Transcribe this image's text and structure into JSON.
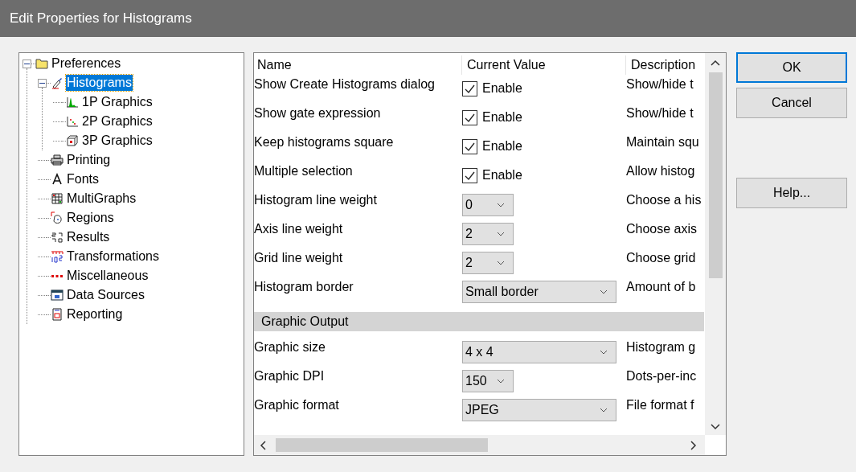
{
  "window": {
    "title": "Edit Properties for Histograms"
  },
  "tree": [
    {
      "label": "Preferences",
      "expanded": true,
      "selected": false,
      "children": [
        {
          "label": "Histograms",
          "expanded": true,
          "selected": true,
          "children": [
            {
              "label": "1P Graphics",
              "selected": false
            },
            {
              "label": "2P Graphics",
              "selected": false
            },
            {
              "label": "3P Graphics",
              "selected": false
            }
          ]
        },
        {
          "label": "Printing",
          "selected": false
        },
        {
          "label": "Fonts",
          "selected": false
        },
        {
          "label": "MultiGraphs",
          "selected": false
        },
        {
          "label": "Regions",
          "selected": false
        },
        {
          "label": "Results",
          "selected": false
        },
        {
          "label": "Transformations",
          "selected": false
        },
        {
          "label": "Miscellaneous",
          "selected": false
        },
        {
          "label": "Data Sources",
          "selected": false
        },
        {
          "label": "Reporting",
          "selected": false
        }
      ]
    }
  ],
  "grid": {
    "columns": [
      "Name",
      "Current Value",
      "Description"
    ],
    "rows": [
      {
        "kind": "checkbox",
        "name": "Show Create Histograms dialog",
        "checked": true,
        "value": "Enable",
        "description": "Show/hide t"
      },
      {
        "kind": "checkbox",
        "name": "Show gate expression",
        "checked": true,
        "value": "Enable",
        "description": "Show/hide t"
      },
      {
        "kind": "checkbox",
        "name": "Keep histograms square",
        "checked": true,
        "value": "Enable",
        "description": "Maintain squ"
      },
      {
        "kind": "checkbox",
        "name": "Multiple selection",
        "checked": true,
        "value": "Enable",
        "description": "Allow histog"
      },
      {
        "kind": "dropdown",
        "name": "Histogram line weight",
        "wide": false,
        "value": "0",
        "description": "Choose a his"
      },
      {
        "kind": "dropdown",
        "name": "Axis line weight",
        "wide": false,
        "value": "2",
        "description": "Choose axis"
      },
      {
        "kind": "dropdown",
        "name": "Grid line weight",
        "wide": false,
        "value": "2",
        "description": "Choose grid"
      },
      {
        "kind": "dropdown",
        "name": "Histogram border",
        "wide": true,
        "value": "Small border",
        "description": "Amount of b"
      },
      {
        "kind": "section",
        "name": "Graphic Output"
      },
      {
        "kind": "dropdown",
        "name": "Graphic size",
        "wide": true,
        "value": "4 x 4",
        "description": "Histogram g"
      },
      {
        "kind": "dropdown",
        "name": "Graphic DPI",
        "wide": false,
        "value": "150",
        "description": "Dots-per-inc"
      },
      {
        "kind": "dropdown",
        "name": "Graphic format",
        "wide": true,
        "value": "JPEG",
        "description": "File format f"
      }
    ]
  },
  "buttons": [
    {
      "label": "OK",
      "default": true
    },
    {
      "label": "Cancel",
      "default": false
    },
    {
      "label": "Help...",
      "default": false
    }
  ]
}
